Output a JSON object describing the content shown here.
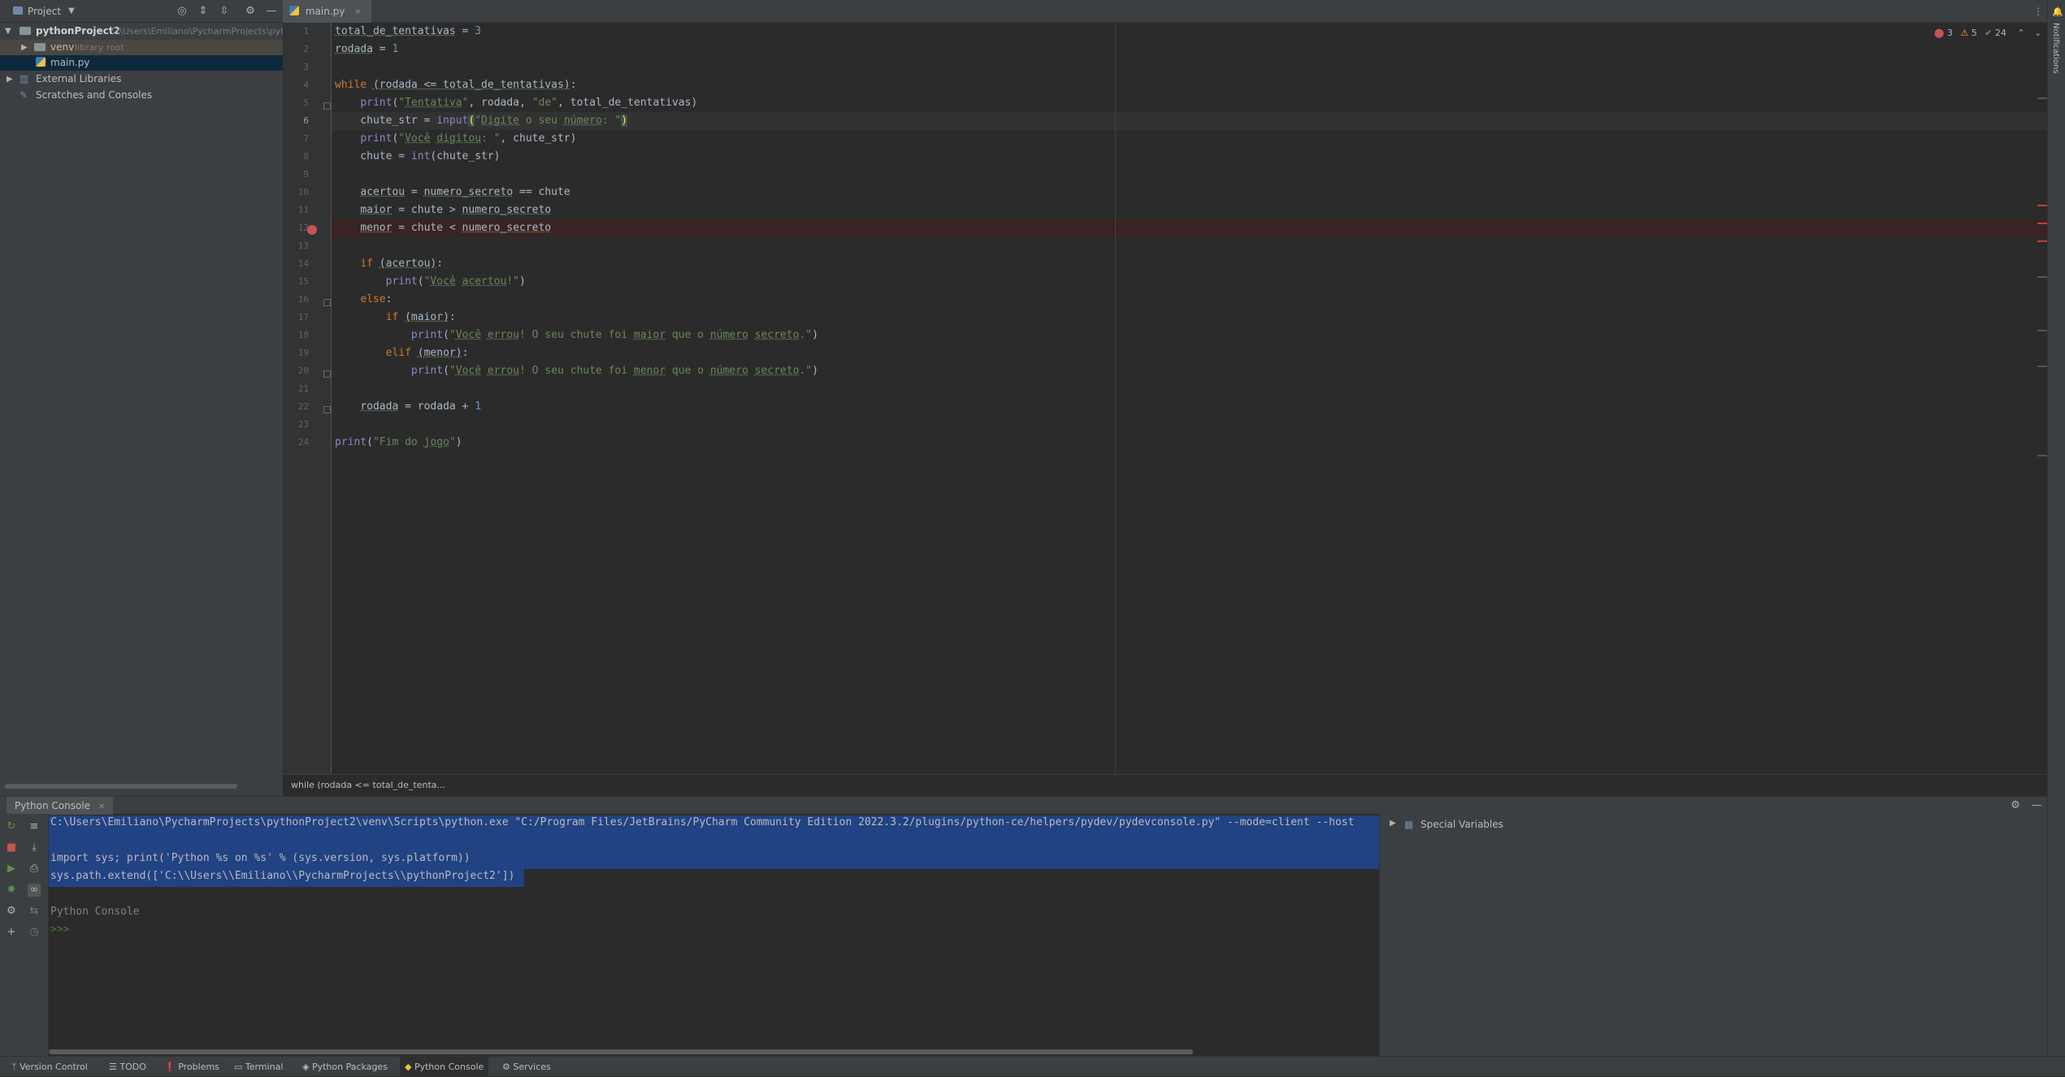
{
  "project": {
    "title": "Project",
    "tree": [
      {
        "name": "pythonProject2",
        "extra": "C:\\Users\\Emiliano\\PycharmProjects\\pyth"
      },
      {
        "name": "venv",
        "extra": "library root"
      },
      {
        "name": "main.py",
        "extra": ""
      },
      {
        "name": "External Libraries",
        "extra": ""
      },
      {
        "name": "Scratches and Consoles",
        "extra": ""
      }
    ]
  },
  "editor": {
    "tab_label": "main.py",
    "breadcrumb": "while (rodada <= total_de_tenta...",
    "inspections": {
      "errors": "3",
      "warnings": "5",
      "ok": "24"
    },
    "line_numbers": [
      "1",
      "2",
      "3",
      "4",
      "5",
      "6",
      "7",
      "8",
      "9",
      "10",
      "11",
      "12",
      "13",
      "14",
      "15",
      "16",
      "17",
      "18",
      "19",
      "20",
      "21",
      "22",
      "23",
      "24"
    ]
  },
  "console": {
    "tab_label": "Python Console",
    "lines": [
      "C:\\Users\\Emiliano\\PycharmProjects\\pythonProject2\\venv\\Scripts\\python.exe \"C:/Program Files/JetBrains/PyCharm Community Edition 2022.3.2/plugins/python-ce/helpers/pydev/pydevconsole.py\" --mode=client --host",
      "",
      "import sys; print('Python %s on %s' % (sys.version, sys.platform))",
      "sys.path.extend(['C:\\\\Users\\\\Emiliano\\\\PycharmProjects\\\\pythonProject2'])",
      "",
      "Python Console",
      ">>>"
    ],
    "variables_label": "Special Variables"
  },
  "bottom_bar": {
    "items": [
      "Version Control",
      "TODO",
      "Problems",
      "Terminal",
      "Python Packages",
      "Python Console",
      "Services"
    ]
  },
  "notifications_label": "Notifications"
}
